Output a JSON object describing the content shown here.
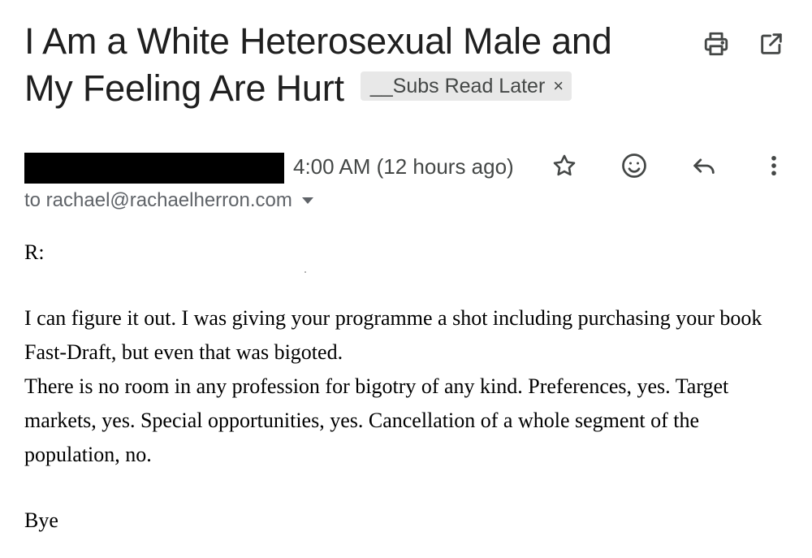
{
  "email": {
    "subject_line_1": "I Am a White Heterosexual Male and",
    "subject_line_2": "My Feeling Are Hurt",
    "label": "__Subs Read Later",
    "label_close": "×",
    "timestamp": "4:00 AM (12 hours ago)",
    "recipient": "to rachael@rachaelherron.com",
    "greeting": "R:",
    "paragraph_1": "I can figure it out. I was giving your programme a shot including purchasing your book Fast-Draft, but even that was bigoted.",
    "paragraph_2": "There is no room in any profession for bigotry of any kind. Preferences, yes. Target markets, yes. Special opportunities, yes. Cancellation of a whole segment of the population, no.",
    "signoff": "Bye"
  },
  "icons": {
    "print": "print-icon",
    "open_new_window": "open-in-new-window-icon",
    "star": "star-icon",
    "emoji": "emoji-icon",
    "reply": "reply-icon",
    "more": "more-vertical-icon"
  },
  "colors": {
    "label_bg": "#e8e8e8",
    "text_primary": "#1f1f1f",
    "text_secondary": "#5f6368",
    "redaction": "#000000"
  }
}
